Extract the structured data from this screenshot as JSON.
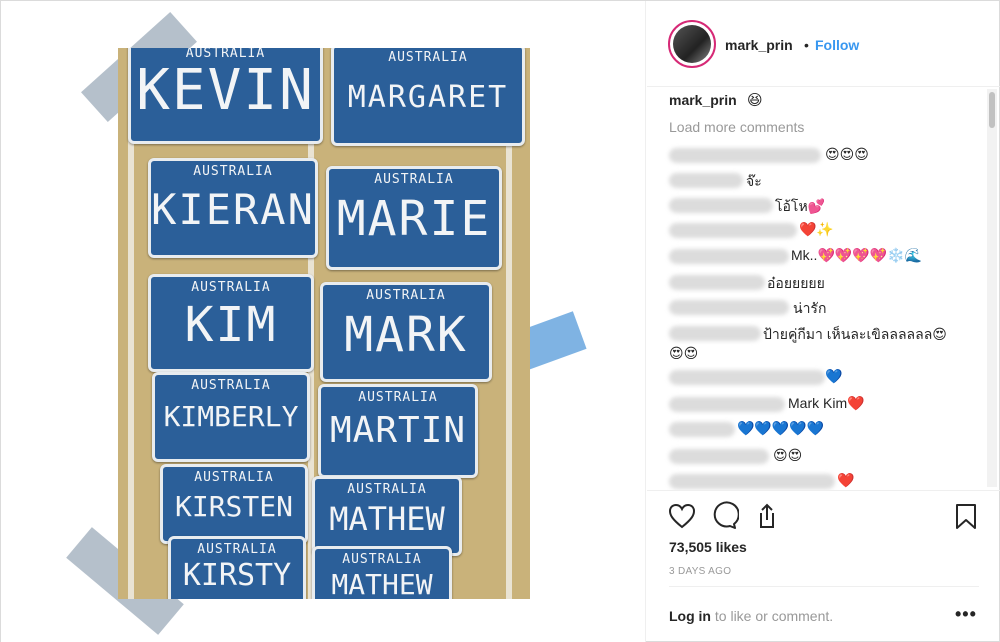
{
  "post": {
    "username": "mark_prin",
    "separator": "•",
    "follow_label": "Follow",
    "caption_user": "mark_prin",
    "caption_text": "😆",
    "load_more": "Load more comments",
    "likes": "73,505 likes",
    "time_ago": "3 DAYS AGO",
    "login_link": "Log in",
    "login_rest": " to like or comment.",
    "more_label": "•••"
  },
  "plates": [
    {
      "au": "AUSTRALIA",
      "name": "KEVIN"
    },
    {
      "au": "AUSTRALIA",
      "name": "MARGARET"
    },
    {
      "au": "AUSTRALIA",
      "name": "KIERAN"
    },
    {
      "au": "AUSTRALIA",
      "name": "MARIE"
    },
    {
      "au": "AUSTRALIA",
      "name": "KIM"
    },
    {
      "au": "AUSTRALIA",
      "name": "MARK"
    },
    {
      "au": "AUSTRALIA",
      "name": "KIMBERLY"
    },
    {
      "au": "AUSTRALIA",
      "name": "MARTIN"
    },
    {
      "au": "AUSTRALIA",
      "name": "KIRSTEN"
    },
    {
      "au": "AUSTRALIA",
      "name": "MATHEW"
    },
    {
      "au": "AUSTRALIA",
      "name": "KIRSTY"
    },
    {
      "au": "AUSTRALIA",
      "name": "MATHEW"
    }
  ],
  "comments": [
    {
      "text": "😍😍😍"
    },
    {
      "text": "จ๊ะ"
    },
    {
      "text": "โอ้โห💕"
    },
    {
      "text": "❤️✨"
    },
    {
      "text": "Mk..💖💖💖💖❄️🌊"
    },
    {
      "text": "อ๋อยยยยย"
    },
    {
      "text": "น่ารัก"
    },
    {
      "text": "ป้ายคู่กีมา เห็นละเขิลลลลลล😍"
    },
    {
      "text": "😍😍"
    },
    {
      "text": "💙"
    },
    {
      "text": "Mark Kim❤️"
    },
    {
      "text": "💙💙💙💙💙"
    },
    {
      "text": "😍😍"
    },
    {
      "text": "❤️"
    }
  ],
  "icons": {
    "heart": "heart-icon",
    "comment": "comment-icon",
    "share": "share-icon",
    "bookmark": "bookmark-icon"
  },
  "colors": {
    "link": "#3897f0",
    "text": "#262626",
    "muted": "#999999",
    "plate": "#2b5f99"
  }
}
